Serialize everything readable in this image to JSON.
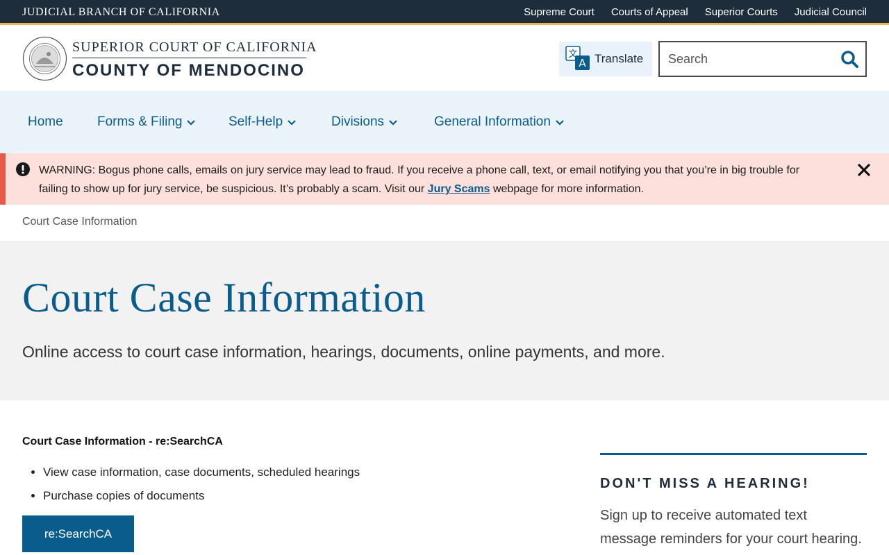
{
  "topbar": {
    "brand": "JUDICIAL BRANCH OF CALIFORNIA",
    "links": [
      "Supreme Court",
      "Courts of Appeal",
      "Superior Courts",
      "Judicial Council"
    ]
  },
  "header": {
    "line1": "SUPERIOR COURT OF CALIFORNIA",
    "line2": "COUNTY OF MENDOCINO",
    "translate_label": "Translate",
    "search_placeholder": "Search"
  },
  "nav": {
    "items": [
      {
        "label": "Home",
        "dropdown": false
      },
      {
        "label": "Forms & Filing",
        "dropdown": true
      },
      {
        "label": "Self-Help",
        "dropdown": true
      },
      {
        "label": "Divisions",
        "dropdown": true
      },
      {
        "label": "General Information",
        "dropdown": true
      }
    ]
  },
  "alert": {
    "text_before": "WARNING: Bogus phone calls, emails on jury service may lead to fraud.  If you receive a phone call, text, or email notifying you that you’re in big trouble for failing to show up for jury service, be suspicious.  It’s probably a scam.  Visit our ",
    "link": "Jury Scams",
    "text_after": " webpage for more information."
  },
  "breadcrumb": "Court Case Information",
  "hero": {
    "title": "Court Case Information",
    "subtitle": "Online access to court case information, hearings, documents, online payments, and more."
  },
  "content": {
    "section_title": "Court Case Information  - re:SearchCA",
    "bullets": [
      "View case information, case documents, scheduled hearings",
      "Purchase copies of documents"
    ],
    "button": "re:SearchCA"
  },
  "sidebar": {
    "title": "DON'T MISS A HEARING!",
    "text": "Sign up to receive automated text message reminders for your court hearing."
  },
  "colors": {
    "topbar_bg": "#1e2d3b",
    "accent_gold": "#e9b64a",
    "primary_blue": "#0a5c8c",
    "nav_bg": "#ebf3fa",
    "alert_bg": "#fde0db",
    "alert_border": "#e8594a",
    "hero_bg": "#f2f2f2"
  }
}
